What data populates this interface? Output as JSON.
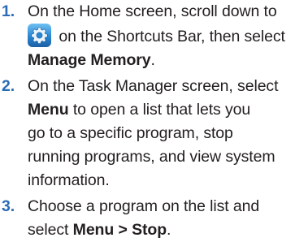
{
  "steps": [
    {
      "number": "1.",
      "line1": "On the Home screen, scroll down to",
      "line2_after_icon": " on the Shortcuts Bar, then select",
      "line3_bold": "Manage Memory",
      "line3_tail": ".",
      "icon": "gear-icon"
    },
    {
      "number": "2.",
      "line1": "On the Task Manager screen, select",
      "line2_bold": "Menu",
      "line2_tail": " to open a list that lets you",
      "line3": "go to a specific program, stop",
      "line4": "running programs, and view system",
      "line5": "information."
    },
    {
      "number": "3.",
      "line1": "Choose a program on the list and",
      "line2_head": "select ",
      "line2_bold": "Menu > Stop",
      "line2_tail": "."
    }
  ],
  "colors": {
    "step_number": "#2a6db5",
    "text": "#231f20",
    "icon_bg": "#2a86d0"
  }
}
